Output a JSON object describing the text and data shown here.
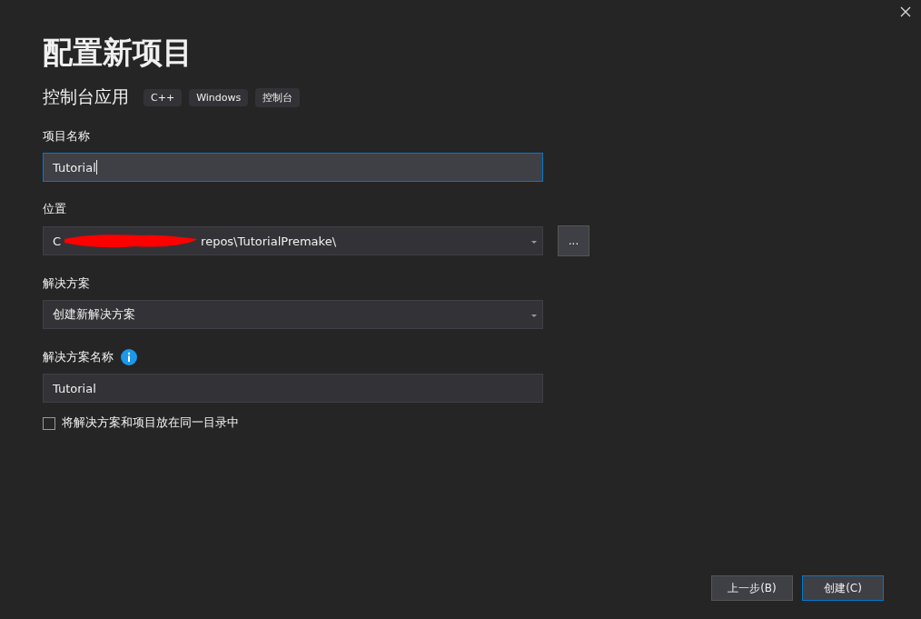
{
  "title": "配置新项目",
  "template": {
    "name": "控制台应用",
    "tags": [
      "C++",
      "Windows",
      "控制台"
    ]
  },
  "project_name": {
    "label": "项目名称",
    "value": "Tutorial",
    "focused": true
  },
  "location": {
    "label": "位置",
    "value_before_redaction": "C",
    "value_after_redaction": "repos\\TutorialPremake\\",
    "browse_button": "..."
  },
  "solution": {
    "label": "解决方案",
    "value": "创建新解决方案"
  },
  "solution_name": {
    "label": "解决方案名称",
    "value": "Tutorial"
  },
  "same_directory": {
    "label": "将解决方案和项目放在同一目录中",
    "checked": false
  },
  "buttons": [
    {
      "label": "上一步(B)",
      "primary": false
    },
    {
      "label": "创建(C)",
      "primary": true
    }
  ]
}
